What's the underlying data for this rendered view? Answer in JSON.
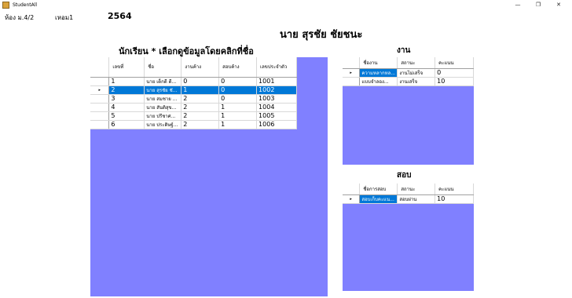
{
  "window": {
    "title": "StudentAll",
    "minimize": "—",
    "maximize": "❐",
    "close": "✕"
  },
  "header": {
    "room": "ห้อง ม.4/2",
    "group": "เหอม1",
    "year": "2564"
  },
  "selected_name": "นาย สุรชัย ชัยชนะ",
  "students": {
    "title": "นักเรียน * เลือกดูข้อมูลโดยคลิกที่ชื่อ",
    "columns": [
      "เลขที่",
      "ชื่อ",
      "งานค้าง",
      "สอบค้าง",
      "เลขประจำตัว"
    ],
    "rows": [
      [
        "1",
        "นาย เด็กดี ดี...",
        "0",
        "0",
        "1001"
      ],
      [
        "2",
        "นาย สุรชัย ชั...",
        "1",
        "0",
        "1002"
      ],
      [
        "3",
        "นาย สมชาย ...",
        "2",
        "0",
        "1003"
      ],
      [
        "4",
        "นาย สันติสุข...",
        "2",
        "1",
        "1004"
      ],
      [
        "5",
        "นาย ปรีชาศ...",
        "2",
        "1",
        "1005"
      ],
      [
        "6",
        "นาย ประดิษฐ์...",
        "2",
        "1",
        "1006"
      ]
    ],
    "selected_row": 1
  },
  "work": {
    "title": "งาน",
    "columns": [
      "ชื่องาน",
      "สถานะ",
      "คะแนน"
    ],
    "rows": [
      [
        "ความหลากหล...",
        "งานไม่เสร็จ",
        "0"
      ],
      [
        "แบบจำลอง...",
        "งานเสร็จ",
        "10"
      ]
    ]
  },
  "exam": {
    "title": "สอบ",
    "columns": [
      "ชื่อการสอบ",
      "สถานะ",
      "คะแนน"
    ],
    "rows": [
      [
        "สอบเก็บคะแน...",
        "สอบผ่าน",
        "10"
      ]
    ]
  },
  "colors": {
    "grid_background": "#8080ff",
    "selection": "#0078d7"
  }
}
